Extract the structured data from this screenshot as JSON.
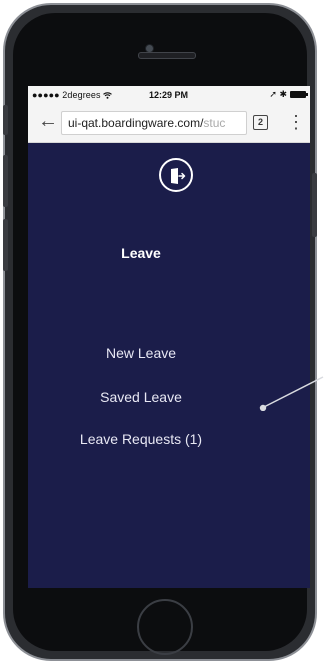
{
  "status_bar": {
    "carrier": "●●●●● 2degrees",
    "wifi_icon": "wifi-icon",
    "time": "12:29 PM",
    "right_icons": "➚ ✱"
  },
  "browser": {
    "back_icon": "←",
    "url_main": "ui-qat.boardingware.com/",
    "url_fade": "stuc",
    "tab_count": "2",
    "menu_icon": "⋮"
  },
  "page": {
    "icon": "exit-door-icon",
    "title": "Leave",
    "menu": [
      {
        "label": "New Leave"
      },
      {
        "label": "Saved Leave"
      },
      {
        "label": "Leave Requests (1)"
      }
    ]
  },
  "colors": {
    "screen_bg": "#1b1d4a",
    "text": "#ffffff",
    "annotation": "#d9dbe0"
  }
}
